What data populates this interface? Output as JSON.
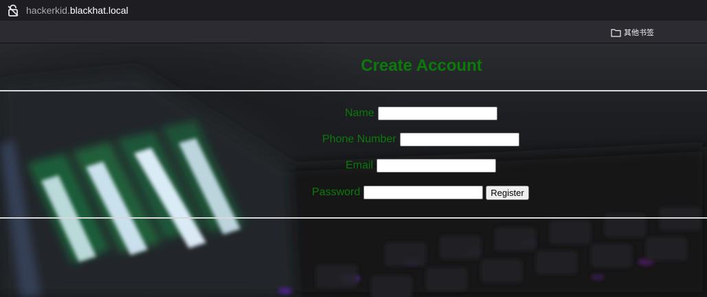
{
  "browser": {
    "url_subdomain": "hackerkid.",
    "url_domain": "blackhat.local",
    "bookmarks": {
      "other_bookmarks_label": "其他书签"
    }
  },
  "form": {
    "title": "Create Account",
    "fields": [
      {
        "label": "Name",
        "value": "",
        "type": "text"
      },
      {
        "label": "Phone Number",
        "value": "",
        "type": "text"
      },
      {
        "label": "Email",
        "value": "",
        "type": "text"
      },
      {
        "label": "Password",
        "value": "",
        "type": "password"
      }
    ],
    "submit_label": "Register"
  },
  "colors": {
    "label_green": "#0b7a0b",
    "rule": "#d8d8d8",
    "browser_chrome": "#1e1d22"
  }
}
